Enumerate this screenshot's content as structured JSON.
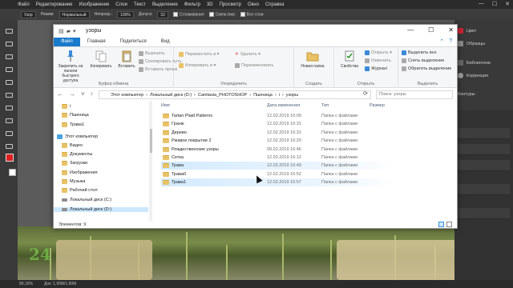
{
  "photoshop": {
    "menu": [
      "Файл",
      "Редактирование",
      "Изображение",
      "Слои",
      "Текст",
      "Выделение",
      "Фильтр",
      "3D",
      "Просмотр",
      "Окно",
      "Справка"
    ],
    "options": {
      "mode_label": "Узор",
      "mode_label2": "Режим:",
      "mode_value": "Нормальный",
      "opacity_label": "Непрозр.:",
      "opacity_value": "100%",
      "tolerance_label": "Допуск:",
      "tolerance_value": "32",
      "antialias": "Сглаживание",
      "contiguous": "Смеж.пикс",
      "all_layers": "Все слои"
    },
    "panels": {
      "color": "Цвет",
      "swatches": "Образцы",
      "libraries": "Библиотеки",
      "adjustments": "Коррекция",
      "contours": "Контуры"
    },
    "status": {
      "zoom": "89,16%",
      "doc": "Док: 1,90М/1,90М"
    },
    "logo": "24",
    "colors": {
      "foreground": "#e02020",
      "background": "#ffffff"
    }
  },
  "explorer": {
    "title": "узоры",
    "title_icons": [
      "▤",
      "▰",
      "▾"
    ],
    "ribbon_tabs": [
      "Файл",
      "Главная",
      "Поделиться",
      "Вид"
    ],
    "ribbon_groups": [
      {
        "label": "Буфер обмена"
      },
      {
        "label": "Упорядочить"
      },
      {
        "label": "Создать"
      },
      {
        "label": "Открыть"
      },
      {
        "label": "Выделить"
      }
    ],
    "ribbon": {
      "pin": "Закрепить на панели быстрого доступа",
      "copy": "Копировать",
      "paste": "Вставить",
      "cut": "Вырезать",
      "copy_path": "Скопировать путь",
      "paste_shortcut": "Вставить ярлык",
      "move_to": "Переместить в ▾",
      "copy_to": "Копировать в ▾",
      "delete": "Удалить ▾",
      "rename": "Переименовать",
      "new_folder": "Новая папка",
      "new_item": "▾",
      "properties": "Свойства",
      "open": "Открыть ▾",
      "edit": "Изменить",
      "history": "Журнал",
      "select_all": "Выделить все",
      "select_none": "Снять выделение",
      "invert": "Обратить выделение"
    },
    "address": {
      "parts": [
        "Этот компьютер",
        "Локальный диск (D:)",
        "Camtasia_PHOTOSHOP",
        "Пшеница",
        "i",
        "узоры"
      ],
      "search_placeholder": "Поиск: узоры"
    },
    "nav": [
      {
        "label": "i",
        "type": "folder"
      },
      {
        "label": "Пшеница",
        "type": "folder"
      },
      {
        "label": "Трава1",
        "type": "folder"
      },
      {
        "label": "Этот компьютер",
        "type": "pc"
      },
      {
        "label": "Видео",
        "type": "folder"
      },
      {
        "label": "Документы",
        "type": "folder"
      },
      {
        "label": "Загрузки",
        "type": "folder"
      },
      {
        "label": "Изображения",
        "type": "folder"
      },
      {
        "label": "Музыка",
        "type": "folder"
      },
      {
        "label": "Рабочий стол",
        "type": "folder"
      },
      {
        "label": "Локальный диск (C:)",
        "type": "drive"
      },
      {
        "label": "Локальный диск (D:)",
        "type": "drive",
        "selected": true
      }
    ],
    "columns": [
      "Имя",
      "Дата изменения",
      "Тип",
      "Размер"
    ],
    "files": [
      {
        "name": "Tartan Plaid Patterns",
        "date": "12.02.2019 16:09",
        "type": "Папка с файлами"
      },
      {
        "name": "Гранж",
        "date": "12.02.2019 16:31",
        "type": "Папка с файлами"
      },
      {
        "name": "Дерево",
        "date": "12.02.2019 16:31",
        "type": "Папка с файлами"
      },
      {
        "name": "Ржавое покрытие 2",
        "date": "12.02.2019 16:20",
        "type": "Папка с файлами"
      },
      {
        "name": "Рождественские узоры",
        "date": "09.02.2019 16:46",
        "type": "Папка с файлами"
      },
      {
        "name": "Сетка",
        "date": "12.02.2019 16:12",
        "type": "Папка с файлами"
      },
      {
        "name": "Трава",
        "date": "12.02.2019 16:49",
        "type": "Папка с файлами",
        "highlight": true
      },
      {
        "name": "Трава0",
        "date": "12.02.2019 16:52",
        "type": "Папка с файлами"
      },
      {
        "name": "Трава1",
        "date": "12.02.2019 16:57",
        "type": "Папка с файлами",
        "highlight": true
      }
    ],
    "status": "Элементов: 9",
    "win_controls": [
      "—",
      "☐",
      "✕"
    ]
  }
}
